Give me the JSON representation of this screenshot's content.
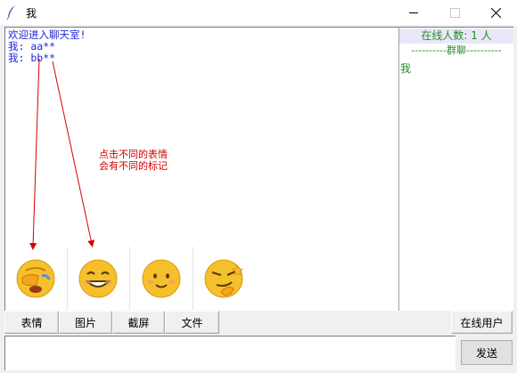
{
  "window": {
    "title": "我",
    "app_icon": "feather-icon",
    "controls": [
      "minimize-icon",
      "maximize-icon",
      "close-icon"
    ]
  },
  "chat": {
    "lines": [
      "欢迎进入聊天室!",
      "我: aa**",
      "我: bb**"
    ],
    "text_color": "#1f25d6"
  },
  "annotation": {
    "lines": [
      "点击不同的表情",
      "会有不同的标记"
    ],
    "color": "#d40000"
  },
  "emojis": [
    {
      "name": "facepalm-emoji"
    },
    {
      "name": "grin-emoji"
    },
    {
      "name": "smile-emoji"
    },
    {
      "name": "smirk-emoji"
    }
  ],
  "sidebar": {
    "online_count": "在线人数: 1 人",
    "group_divider": "----------群聊----------",
    "users": [
      "我"
    ],
    "accent": "#2a8a2a"
  },
  "toolbar": {
    "emoji_label": "表情",
    "image_label": "图片",
    "screenshot_label": "截屏",
    "file_label": "文件",
    "online_users_label": "在线用户"
  },
  "composer": {
    "value": "",
    "send_label": "发送"
  }
}
